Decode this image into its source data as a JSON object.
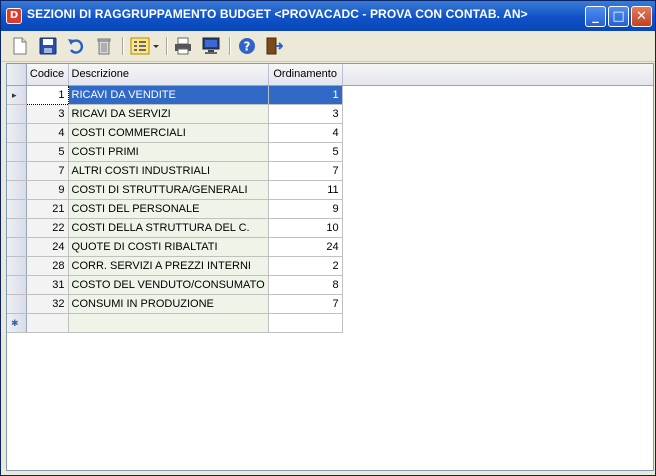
{
  "window": {
    "title": "SEZIONI DI RAGGRUPPAMENTO BUDGET <PROVACADC - PROVA CON CONTAB. AN>",
    "app_icon_letter": "D",
    "minimize_glyph": "_",
    "maximize_glyph": "□",
    "close_glyph": "✕"
  },
  "toolbar": {
    "buttons": [
      "new-document",
      "save",
      "undo",
      "delete",
      "list-view",
      "print",
      "preview-monitor",
      "help",
      "exit-door"
    ]
  },
  "grid": {
    "columns": [
      "Codice",
      "Descrizione",
      "Ordinamento"
    ],
    "rows": [
      {
        "codice": "1",
        "descrizione": "RICAVI DA VENDITE",
        "ordinamento": "1"
      },
      {
        "codice": "3",
        "descrizione": "RICAVI DA SERVIZI",
        "ordinamento": "3"
      },
      {
        "codice": "4",
        "descrizione": "COSTI COMMERCIALI",
        "ordinamento": "4"
      },
      {
        "codice": "5",
        "descrizione": "COSTI PRIMI",
        "ordinamento": "5"
      },
      {
        "codice": "7",
        "descrizione": "ALTRI COSTI INDUSTRIALI",
        "ordinamento": "7"
      },
      {
        "codice": "9",
        "descrizione": "COSTI DI STRUTTURA/GENERALI",
        "ordinamento": "11"
      },
      {
        "codice": "21",
        "descrizione": "COSTI DEL PERSONALE",
        "ordinamento": "9"
      },
      {
        "codice": "22",
        "descrizione": "COSTI DELLA STRUTTURA DEL C.",
        "ordinamento": "10"
      },
      {
        "codice": "24",
        "descrizione": "QUOTE DI COSTI RIBALTATI",
        "ordinamento": "24"
      },
      {
        "codice": "28",
        "descrizione": "CORR. SERVIZI A PREZZI INTERNI",
        "ordinamento": "2"
      },
      {
        "codice": "31",
        "descrizione": "COSTO DEL VENDUTO/CONSUMATO",
        "ordinamento": "8"
      },
      {
        "codice": "32",
        "descrizione": "CONSUMI IN PRODUZIONE",
        "ordinamento": "7"
      }
    ],
    "selected_row_marker": "▸",
    "new_row_marker": "✱"
  },
  "colors": {
    "titlebar": "#0f52c7",
    "selection": "#3169c6",
    "description_column": "#eef4e8"
  }
}
